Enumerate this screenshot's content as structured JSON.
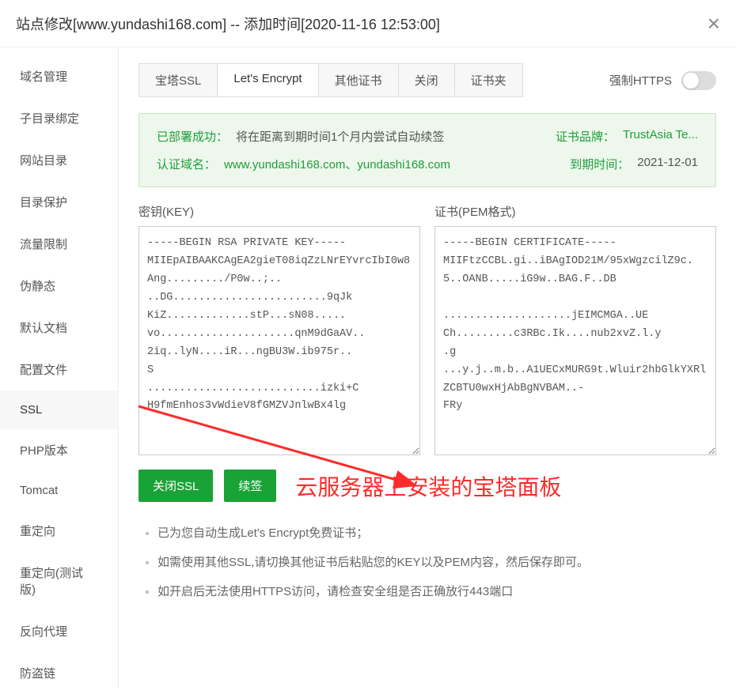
{
  "header": {
    "title": "站点修改[www.yundashi168.com] -- 添加时间[2020-11-16 12:53:00]"
  },
  "sidebar": {
    "items": [
      {
        "label": "域名管理"
      },
      {
        "label": "子目录绑定"
      },
      {
        "label": "网站目录"
      },
      {
        "label": "目录保护"
      },
      {
        "label": "流量限制"
      },
      {
        "label": "伪静态"
      },
      {
        "label": "默认文档"
      },
      {
        "label": "配置文件"
      },
      {
        "label": "SSL"
      },
      {
        "label": "PHP版本"
      },
      {
        "label": "Tomcat"
      },
      {
        "label": "重定向"
      },
      {
        "label": "重定向(测试版)"
      },
      {
        "label": "反向代理"
      },
      {
        "label": "防盗链"
      }
    ],
    "active_index": 8
  },
  "tabs": {
    "items": [
      {
        "label": "宝塔SSL"
      },
      {
        "label": "Let's Encrypt"
      },
      {
        "label": "其他证书"
      },
      {
        "label": "关闭"
      },
      {
        "label": "证书夹"
      }
    ],
    "active_index": 1
  },
  "force_https": {
    "label": "强制HTTPS",
    "enabled": false
  },
  "success_panel": {
    "deploy_label": "已部署成功：",
    "deploy_text": "将在距离到期时间1个月内尝试自动续签",
    "domain_label": "认证域名：",
    "domain_text": "www.yundashi168.com、yundashi168.com",
    "brand_label": "证书品牌：",
    "brand_text": "TrustAsia Te...",
    "expire_label": "到期时间：",
    "expire_text": "2021-12-01"
  },
  "cert": {
    "key_label": "密钥(KEY)",
    "pem_label": "证书(PEM格式)",
    "key_value": "-----BEGIN RSA PRIVATE KEY-----\nMIIEpAIBAAKCAgEA2gieT08iqZzLNrEYvrcIbI0w8Ang........./P0w..;..\n..DG........................9qJk\nKiZ.............stP...sN08.....\nvo.....................qnM9dGaAV..\n2iq..lyN....iR...ngBU3W.ib975r..\nS\n...........................izki+C\nH9fmEnhos3vWdieV8fGMZVJnlwBx4lg",
    "pem_value": "-----BEGIN CERTIFICATE-----\nMIIFtzCCBL.gi..iBAgIOD21M/95xWgzcilZ9c.5..OANB.....iG9w..BAG.F..DB\n\n....................jEIMCMGA..UE\nCh.........c3RBc.Ik....nub2xvZ.l.y\n.g\n...y.j..m.b..A1UECxMURG9t.Wluir2hbGlkYXRlZCBTU0wxHjAbBgNVBAM..-\nFRy"
  },
  "buttons": {
    "close_ssl": "关闭SSL",
    "renew": "续签"
  },
  "annotation": "云服务器上安装的宝塔面板",
  "info_list": [
    "已为您自动生成Let's Encrypt免费证书；",
    "如需使用其他SSL,请切换其他证书后粘贴您的KEY以及PEM内容，然后保存即可。",
    "如开启后无法使用HTTPS访问，请检查安全组是否正确放行443端口"
  ]
}
